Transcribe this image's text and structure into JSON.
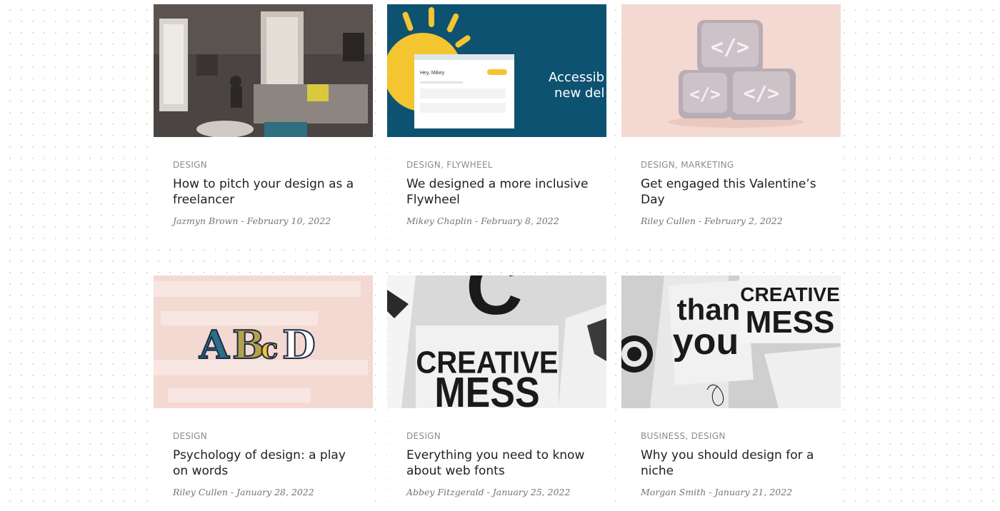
{
  "posts": [
    {
      "categories": "DESIGN",
      "title": "How to pitch your design as a freelancer",
      "author": "Jazmyn Brown",
      "date": "February 10, 2022",
      "image": "living-room-photo"
    },
    {
      "categories": "DESIGN, FLYWHEEL",
      "title": "We designed a more inclusive Flywheel",
      "author": "Mikey Chaplin",
      "date": "February 8, 2022",
      "image": "accessibility-illustration"
    },
    {
      "categories": "DESIGN, MARKETING",
      "title": "Get engaged this Valentine’s Day",
      "author": "Riley Cullen",
      "date": "February 2, 2022",
      "image": "code-blocks-illustration"
    },
    {
      "categories": "DESIGN",
      "title": "Psychology of design: a play on words",
      "author": "Riley Cullen",
      "date": "January 28, 2022",
      "image": "abcd-lettering"
    },
    {
      "categories": "DESIGN",
      "title": "Everything you need to know about web fonts",
      "author": "Abbey Fitzgerald",
      "date": "January 25, 2022",
      "image": "creative-mess-poster"
    },
    {
      "categories": "BUSINESS, DESIGN",
      "title": "Why you should design for a niche",
      "author": "Morgan Smith",
      "date": "January 21, 2022",
      "image": "thank-you-creative-mess-poster"
    }
  ],
  "image_text": {
    "accessibility_headline_1": "Accessib",
    "accessibility_headline_2": "new del",
    "greeting": "Hey, Mikey",
    "code_symbol": "</>",
    "abcd": [
      "A",
      "B",
      "c",
      "D"
    ],
    "creative": "CREATIVE",
    "mess": "MESS",
    "thank": "than",
    "you": "you",
    "c_letter": "C"
  },
  "colors": {
    "category": "#8c8a95",
    "title": "#1f1f22",
    "meta": "#77727a",
    "flywheel_teal": "#0e5271",
    "sun_yellow": "#f2c531",
    "blush": "#f3d9d2"
  }
}
